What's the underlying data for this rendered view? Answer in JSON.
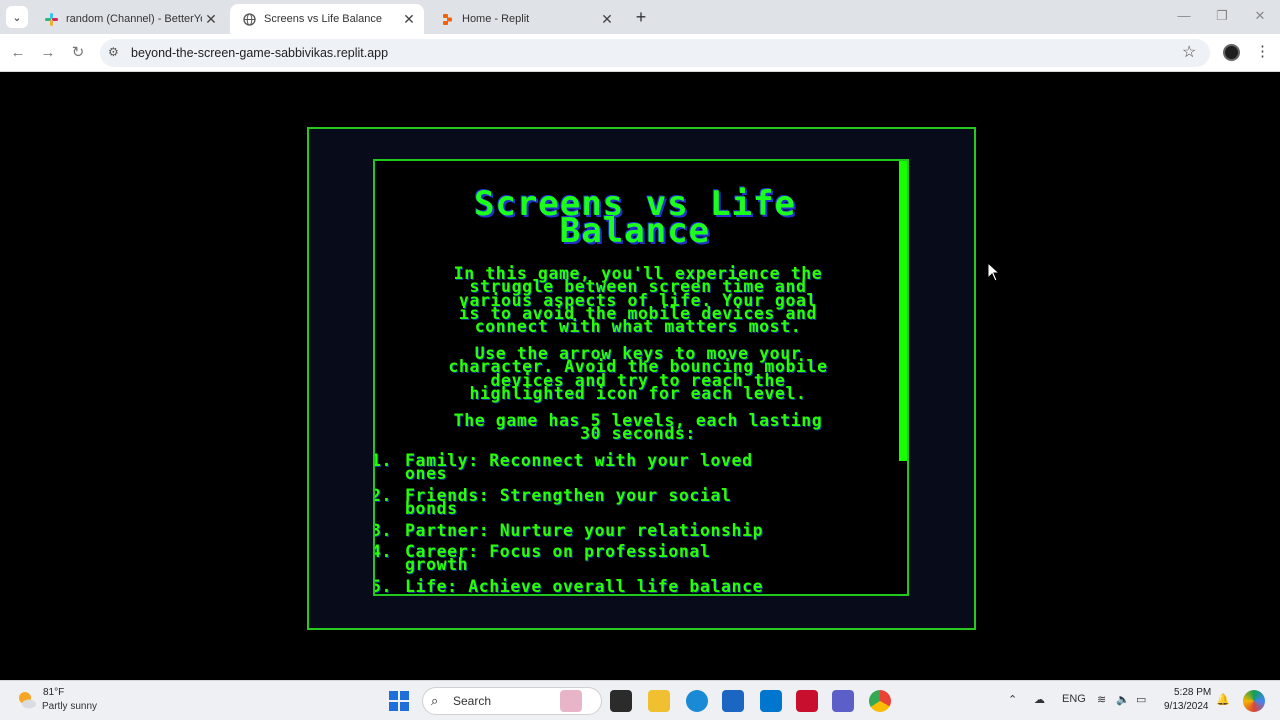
{
  "browser": {
    "tabs": [
      {
        "title": "random (Channel) - BetterYou -",
        "favicon": "slack-icon",
        "active": false
      },
      {
        "title": "Screens vs Life Balance",
        "favicon": "globe-icon",
        "active": true
      },
      {
        "title": "Home - Replit",
        "favicon": "replit-icon",
        "active": false
      }
    ],
    "url": "beyond-the-screen-game-sabbivikas.replit.app"
  },
  "game": {
    "title_line1": "Screens vs Life",
    "title_line2": "Balance",
    "intro": [
      "In this game, you'll experience the",
      "struggle between screen time and",
      "various aspects of life. Your goal",
      "is to avoid the mobile devices and",
      "connect with what matters most."
    ],
    "controls": [
      "Use the arrow keys to move your",
      "character. Avoid the bouncing mobile",
      "devices and try to reach the",
      "highlighted icon for each level."
    ],
    "levels_intro": [
      "The game has 5 levels, each lasting",
      "30 seconds:"
    ],
    "levels": [
      {
        "num": "1.",
        "line1": "Family: Reconnect with your loved",
        "line2": "ones"
      },
      {
        "num": "2.",
        "line1": "Friends: Strengthen your social",
        "line2": "bonds"
      },
      {
        "num": "3.",
        "line1": "Partner: Nurture your relationship",
        "line2": ""
      },
      {
        "num": "4.",
        "line1": "Career: Focus on professional",
        "line2": "growth"
      },
      {
        "num": "5.",
        "line1": "Life: Achieve overall life balance",
        "line2": ""
      }
    ],
    "colors": {
      "text": "#2aff00",
      "border": "#28c81e",
      "title_shadow": "#2233cc"
    }
  },
  "taskbar": {
    "weather_temp": "81°F",
    "weather_desc": "Partly sunny",
    "search_label": "Search",
    "language": "ENG",
    "time": "5:28 PM",
    "date": "9/13/2024"
  }
}
